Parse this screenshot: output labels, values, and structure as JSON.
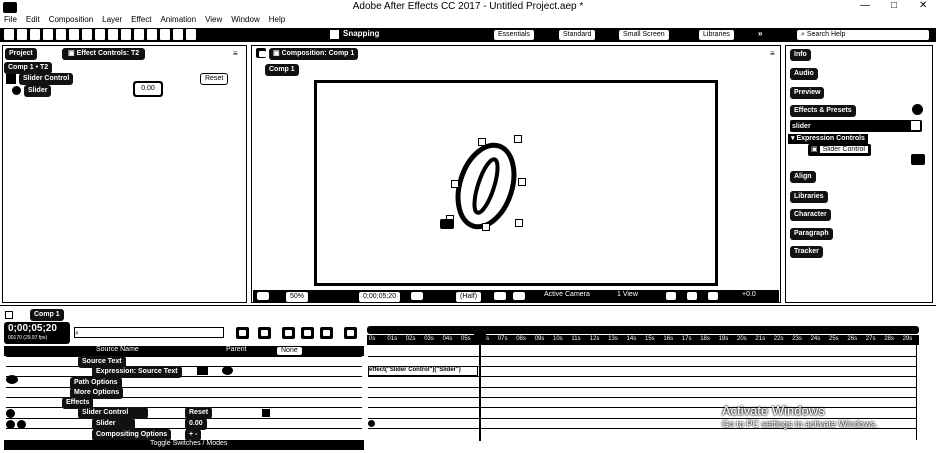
{
  "window": {
    "title": "Adobe After Effects CC 2017 - Untitled Project.aep *",
    "controls": {
      "minimize": "—",
      "maximize": "□",
      "close": "✕"
    }
  },
  "menu": [
    "File",
    "Edit",
    "Composition",
    "Layer",
    "Effect",
    "Animation",
    "View",
    "Window",
    "Help"
  ],
  "toolbar": {
    "snapping": "Snapping",
    "workspaces": [
      "Essentials",
      "Standard",
      "Small Screen",
      "Libraries"
    ],
    "workspace_more": "»",
    "search_help": "Search Help"
  },
  "project_panel": {
    "tab_project": "Project",
    "tab_effect_controls": "Effect Controls: T2",
    "breadcrumb": "Comp 1 • T2",
    "effect_name": "Slider Control",
    "reset_label": "Reset",
    "slider_label": "Slider",
    "slider_value": "0.00"
  },
  "composition_panel": {
    "tab_label": "Composition: Comp 1",
    "comp_tab": "Comp 1",
    "glyph_text": "0",
    "footer": {
      "zoom": "50%",
      "timecode": "0;00;05;20",
      "resolution": "(Half)",
      "camera": "Active Camera",
      "views": "1 View",
      "exposure": "+0.0"
    }
  },
  "right_panel": {
    "search_help": "Search Help",
    "items": [
      "Info",
      "Audio",
      "Preview",
      "Effects & Presets",
      "Align",
      "Libraries",
      "Character",
      "Paragraph",
      "Tracker"
    ],
    "effects_search_value": "slider",
    "expression_controls": "Expression Controls",
    "slider_control": "Slider Control"
  },
  "timeline": {
    "tab_label": "Comp 1",
    "timecode": "0;00;05;20",
    "frame_info": "00170 (29.97 fps)",
    "search_placeholder": "",
    "column_source": "Source Name",
    "column_parent": "Parent",
    "parent_value": "None",
    "rows": [
      {
        "label": "Source Text",
        "indent": 1
      },
      {
        "label": "Expression: Source Text",
        "indent": 2
      },
      {
        "label": "Path Options",
        "indent": 1
      },
      {
        "label": "More Options",
        "indent": 1
      },
      {
        "label": "Effects",
        "indent": 0
      },
      {
        "label": "Slider Control",
        "indent": 1,
        "reset": "Reset"
      },
      {
        "label": "Slider",
        "indent": 2,
        "value": "0.00"
      },
      {
        "label": "Compositing Options",
        "indent": 2,
        "value": "+ -"
      }
    ],
    "expression_text": "effect(\"Slider Control\")(\"Slider\")",
    "footer": "Toggle Switches / Modes",
    "ruler_labels": [
      "0s",
      "01s",
      "02s",
      "03s",
      "04s",
      "05s",
      "06s",
      "07s",
      "08s",
      "09s",
      "10s",
      "11s",
      "12s",
      "13s",
      "14s",
      "15s",
      "16s",
      "17s",
      "18s",
      "19s",
      "20s",
      "21s",
      "22s",
      "23s",
      "24s",
      "25s",
      "26s",
      "27s",
      "28s",
      "29s"
    ]
  },
  "watermark": {
    "line1": "Activate Windows",
    "line2": "Go to PC settings to activate Windows."
  }
}
